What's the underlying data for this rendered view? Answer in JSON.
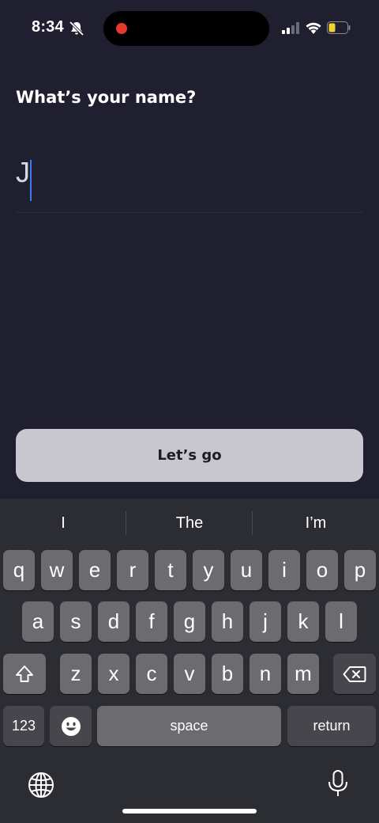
{
  "status_bar": {
    "time": "8:34",
    "mute_icon": "bell-slash-icon",
    "recording_color": "#e5392d",
    "battery_color": "#f2d230"
  },
  "onboarding": {
    "title": "What’s your name?",
    "name_value": "J",
    "cta_label": "Let’s go"
  },
  "keyboard": {
    "suggestions": [
      "I",
      "The",
      "I’m"
    ],
    "rows": [
      [
        "q",
        "w",
        "e",
        "r",
        "t",
        "y",
        "u",
        "i",
        "o",
        "p"
      ],
      [
        "a",
        "s",
        "d",
        "f",
        "g",
        "h",
        "j",
        "k",
        "l"
      ],
      [
        "z",
        "x",
        "c",
        "v",
        "b",
        "n",
        "m"
      ]
    ],
    "numbers_label": "123",
    "space_label": "space",
    "return_label": "return"
  },
  "colors": {
    "background": "#1f1f2f",
    "caret": "#3b7cf5",
    "button": "#c8c7cf"
  }
}
